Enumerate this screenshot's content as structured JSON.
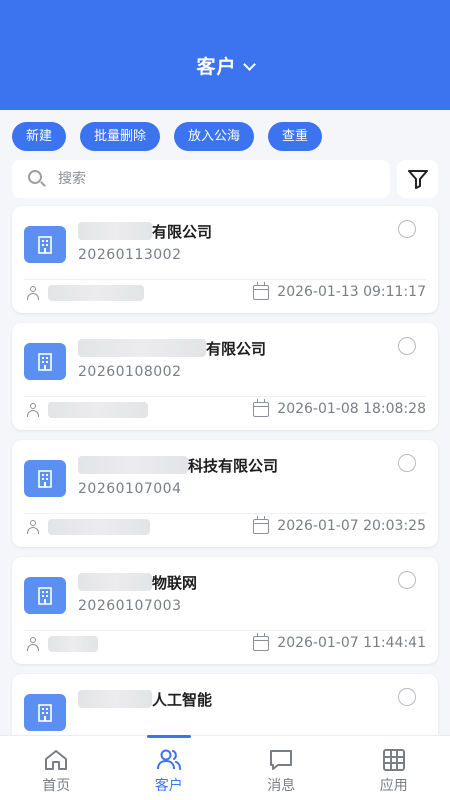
{
  "header": {
    "title": "客户"
  },
  "actions": [
    "新建",
    "批量删除",
    "放入公海",
    "查重"
  ],
  "search": {
    "placeholder": "搜索"
  },
  "customers": [
    {
      "title": "有限公司",
      "code": "20260113002",
      "date": "2026-01-13 09:11:17"
    },
    {
      "title": "有限公司",
      "code": "20260108002",
      "date": "2026-01-08 18:08:28"
    },
    {
      "title": "科技有限公司",
      "code": "20260107004",
      "date": "2026-01-07 20:03:25"
    },
    {
      "title": "物联网",
      "code": "20260107003",
      "date": "2026-01-07 11:44:41"
    },
    {
      "title": "人工智能",
      "code": "",
      "date": ""
    }
  ],
  "tabs": [
    {
      "label": "首页",
      "icon": "home-icon"
    },
    {
      "label": "客户",
      "icon": "users-icon",
      "active": true
    },
    {
      "label": "消息",
      "icon": "message-icon"
    },
    {
      "label": "应用",
      "icon": "grid-icon"
    }
  ],
  "colors": {
    "primary": "#3b74ee",
    "icon_bg": "#5b8ff2",
    "page_bg": "#f4f6fa"
  }
}
